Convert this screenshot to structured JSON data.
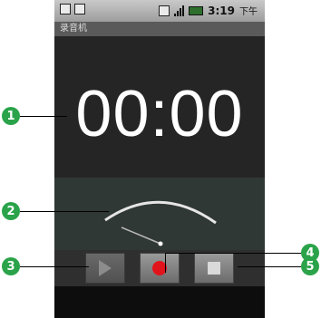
{
  "status_bar": {
    "time": "3:19",
    "ampm": "下午"
  },
  "app": {
    "title": "录音机"
  },
  "timer": {
    "display": "00:00"
  },
  "meter": {
    "needle_level": 0.0
  },
  "controls": {
    "play": "play",
    "record": "record",
    "stop": "stop"
  },
  "callouts": [
    "1",
    "2",
    "3",
    "4",
    "5"
  ],
  "colors": {
    "callout": "#2aa34a",
    "record": "#e1141b"
  }
}
